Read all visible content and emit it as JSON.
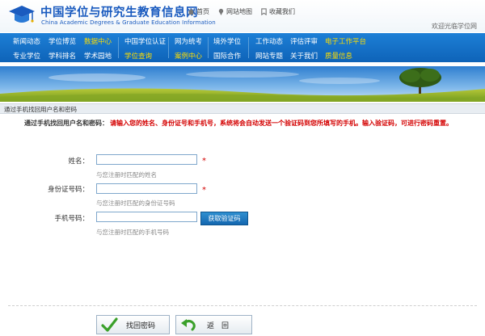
{
  "header": {
    "title": "中国学位与研究生教育信息网",
    "subtitle": "China Academic Degrees & Graduate Education Information",
    "links": [
      {
        "icon": "home-icon",
        "label": "首页"
      },
      {
        "icon": "map-pin-icon",
        "label": "网站地图"
      },
      {
        "icon": "bookmark-icon",
        "label": "收藏我们"
      }
    ],
    "welcome": "欢迎光临学位网"
  },
  "nav": {
    "groups": [
      [
        {
          "label": "新闻动态"
        },
        {
          "label": "学位博览"
        },
        {
          "label": "数据中心",
          "highlight": true
        },
        {
          "label": "专业学位"
        },
        {
          "label": "学科排名"
        },
        {
          "label": "学术园地"
        }
      ],
      [
        {
          "label": "中国学位认证"
        },
        {
          "label": "学位查询",
          "highlight": true
        }
      ],
      [
        {
          "label": "网为统考"
        },
        {
          "label": "案例中心",
          "highlight": true
        }
      ],
      [
        {
          "label": "境外学位"
        },
        {
          "label": "国际合作"
        }
      ],
      [
        {
          "label": "工作动态"
        },
        {
          "label": "评估评审"
        },
        {
          "label": "电子工作平台",
          "highlight": true
        },
        {
          "label": "网站专题"
        },
        {
          "label": "关于我们"
        },
        {
          "label": "质量信息",
          "highlight": true
        }
      ]
    ]
  },
  "breadcrumb": "通过手机找回用户名和密码",
  "instruction": {
    "label": "通过手机找回用户名和密码：",
    "text": "请输入您的姓名、身份证号和手机号，系统将会自动发送一个验证码到您所填写的手机。输入验证码，可进行密码重置。"
  },
  "form": {
    "name": {
      "label": "姓名：",
      "value": "",
      "hint": "与您注册时匹配的姓名",
      "required": "*"
    },
    "id_card": {
      "label": "身份证号码：",
      "value": "",
      "hint": "与您注册时匹配的身份证号码",
      "required": "*"
    },
    "phone": {
      "label": "手机号码：",
      "value": "",
      "hint": "与您注册时匹配的手机号码"
    },
    "get_code": "获取验证码"
  },
  "buttons": {
    "retrieve": "找回密码",
    "back": "返　回"
  },
  "colors": {
    "nav_blue": "#1470c6",
    "highlight_yellow": "#ffde00",
    "alert_red": "#d40000",
    "button_blue": "#1f7ac1"
  }
}
